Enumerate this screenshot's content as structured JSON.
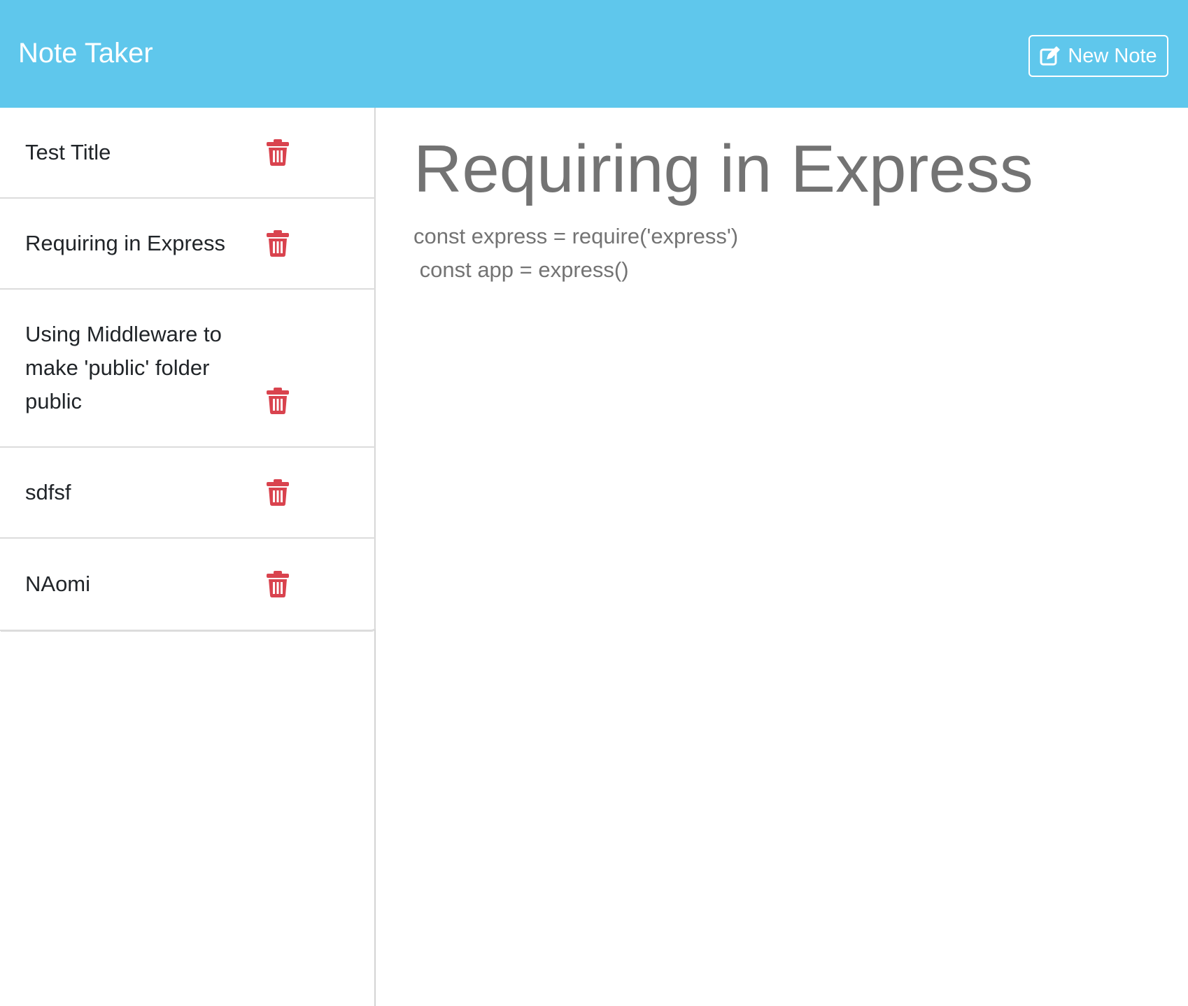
{
  "navbar": {
    "brand": "Note Taker",
    "new_note_label": "New Note"
  },
  "notes": [
    {
      "title": "Test Title"
    },
    {
      "title": "Requiring in Express"
    },
    {
      "title": "Using Middleware to make 'public' folder public"
    },
    {
      "title": "sdfsf"
    },
    {
      "title": "NAomi"
    }
  ],
  "active_note": {
    "title": "Requiring in Express",
    "text": "const express = require('express')\n const app = express()"
  },
  "colors": {
    "navbar": "#5fc7ec",
    "trash": "#d9434e",
    "note_text": "#737373"
  },
  "icons": {
    "new_note": "pen-to-square-icon",
    "delete": "trash-icon"
  }
}
